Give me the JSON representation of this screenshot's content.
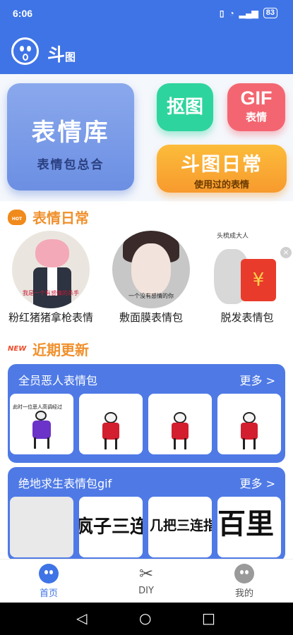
{
  "status": {
    "time": "6:06",
    "battery": "83"
  },
  "app": {
    "title": "斗",
    "title_small": "图"
  },
  "cards": {
    "library": {
      "title": "表情库",
      "subtitle": "表情包总合"
    },
    "cutout": {
      "title": "抠图"
    },
    "gif": {
      "title": "GIF",
      "subtitle": "表情"
    },
    "daily": {
      "title": "斗图日常",
      "subtitle": "使用过的表情"
    }
  },
  "daily_section": {
    "badge": "HOT",
    "title": "表情日常",
    "items": [
      {
        "name": "粉红猪猪拿枪表情",
        "caption": "我是一个有感情的杀手"
      },
      {
        "name": "敷面膜表情包",
        "caption": "一个没有感情的你"
      },
      {
        "name": "脱发表情包",
        "caption": "头梳成大人"
      }
    ],
    "close": "×"
  },
  "recent_section": {
    "badge": "NEW",
    "title": "近期更新"
  },
  "packs": [
    {
      "title": "全员恶人表情包",
      "more": "更多 >",
      "thumb_text": "此时一位恶人高调经过"
    },
    {
      "title": "绝地求生表情包gif",
      "more": "更多 >",
      "thumbs": [
        "",
        "疯子三连",
        "几把三连指",
        "百里"
      ]
    }
  ],
  "nav": {
    "items": [
      {
        "label": "首页"
      },
      {
        "label": "DIY"
      },
      {
        "label": "我的"
      }
    ]
  },
  "system_nav": {
    "back": "◁",
    "home": "○",
    "recent": "□"
  }
}
